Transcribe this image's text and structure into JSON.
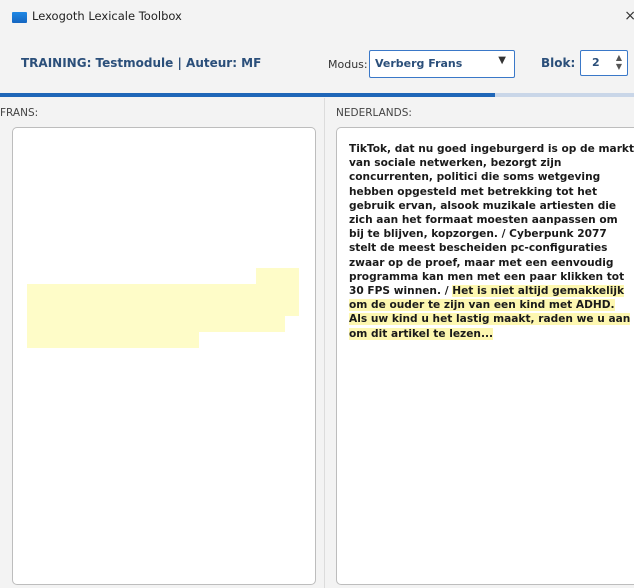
{
  "window": {
    "title": "Lexogoth Lexicale Toolbox",
    "close_glyph": "×",
    "icon": "app-icon"
  },
  "header": {
    "training": "TRAINING: Testmodule | Auteur: MF",
    "modus_label": "Modus:",
    "modus_value": "Verberg Frans",
    "blok_label": "Blok:",
    "blok_value": "2"
  },
  "progress": {
    "fraction": 0.78
  },
  "panes": {
    "left": {
      "label": "FRANS:",
      "content_hidden": true
    },
    "right": {
      "label": "NEDERLANDS:",
      "text_plain": "TikTok, dat nu goed ingeburgerd is op de markt van sociale netwerken, bezorgt zijn concurrenten, politici die soms wetgeving hebben opgesteld met betrekking tot het gebruik ervan, alsook muzikale artiesten die zich aan het formaat moesten aanpassen om bij te blijven, kopzorgen. / Cyberpunk 2077 stelt de meest bescheiden pc-configuraties zwaar op de proef, maar met een eenvoudig programma kan men met een paar klikken tot 30 FPS winnen. / ",
      "text_highlighted": "Het is niet altijd gemakkelijk om de ouder te zijn van een kind met ADHD. Als uw kind u het lastig maakt, raden we u aan om dit artikel te lezen..."
    }
  },
  "colors": {
    "accent": "#1f66b8",
    "label_blue": "#2b4f7a",
    "highlight": "#fefcc8"
  }
}
